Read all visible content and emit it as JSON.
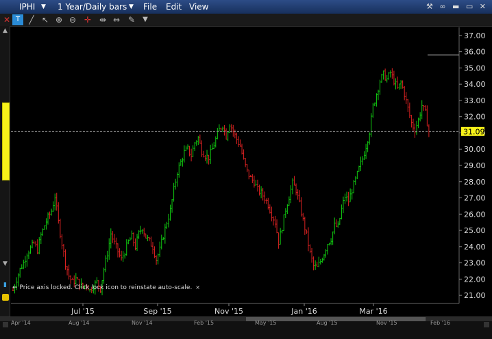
{
  "header": {
    "symbol": "IPHI",
    "period": "1 Year/Daily bars",
    "menu": [
      "File",
      "Edit",
      "View"
    ]
  },
  "note": {
    "text": "Price axis locked. Click lock icon to reinstate auto-scale."
  },
  "chart_data": {
    "type": "ohlc",
    "y_ticks": [
      "21.00",
      "22.00",
      "23.00",
      "24.00",
      "25.00",
      "26.00",
      "27.00",
      "28.00",
      "29.00",
      "30.00",
      "31.00",
      "32.00",
      "33.00",
      "34.00",
      "35.00",
      "36.00",
      "37.00"
    ],
    "ylim": [
      20.5,
      37.5
    ],
    "x_labels": [
      "Jul '15",
      "Sep '15",
      "Nov '15",
      "Jan '16",
      "Mar '16"
    ],
    "last_price": "31.09",
    "last_value": 31.09,
    "h_line_value": 35.8,
    "price_series": [
      [
        0,
        21.3
      ],
      [
        4,
        22.0
      ],
      [
        8,
        22.6
      ],
      [
        12,
        23.0
      ],
      [
        16,
        23.6
      ],
      [
        20,
        23.9
      ],
      [
        24,
        24.2
      ],
      [
        28,
        23.8
      ],
      [
        32,
        24.7
      ],
      [
        36,
        25.3
      ],
      [
        40,
        25.8
      ],
      [
        44,
        26.2
      ],
      [
        48,
        27.1
      ],
      [
        52,
        25.5
      ],
      [
        56,
        24.2
      ],
      [
        60,
        23.0
      ],
      [
        64,
        22.2
      ],
      [
        68,
        21.8
      ],
      [
        72,
        22.0
      ],
      [
        76,
        21.7
      ],
      [
        80,
        21.5
      ],
      [
        84,
        21.7
      ],
      [
        88,
        21.3
      ],
      [
        92,
        21.6
      ],
      [
        96,
        21.8
      ],
      [
        100,
        21.4
      ],
      [
        104,
        22.6
      ],
      [
        108,
        23.6
      ],
      [
        112,
        24.8
      ],
      [
        116,
        24.2
      ],
      [
        120,
        23.7
      ],
      [
        124,
        23.2
      ],
      [
        128,
        23.7
      ],
      [
        132,
        24.3
      ],
      [
        136,
        24.6
      ],
      [
        140,
        24.0
      ],
      [
        144,
        24.8
      ],
      [
        148,
        25.2
      ],
      [
        152,
        24.6
      ],
      [
        156,
        24.3
      ],
      [
        160,
        24.0
      ],
      [
        164,
        23.2
      ],
      [
        168,
        23.8
      ],
      [
        172,
        24.7
      ],
      [
        176,
        25.5
      ],
      [
        180,
        26.2
      ],
      [
        184,
        27.5
      ],
      [
        188,
        28.6
      ],
      [
        192,
        29.2
      ],
      [
        196,
        29.8
      ],
      [
        200,
        30.0
      ],
      [
        204,
        29.6
      ],
      [
        208,
        30.4
      ],
      [
        212,
        30.7
      ],
      [
        216,
        29.9
      ],
      [
        220,
        29.6
      ],
      [
        224,
        29.5
      ],
      [
        228,
        30.0
      ],
      [
        232,
        30.6
      ],
      [
        236,
        31.2
      ],
      [
        240,
        31.5
      ],
      [
        244,
        30.8
      ],
      [
        248,
        31.6
      ],
      [
        252,
        31.1
      ],
      [
        256,
        30.6
      ],
      [
        260,
        30.2
      ],
      [
        264,
        29.3
      ],
      [
        268,
        28.6
      ],
      [
        272,
        28.2
      ],
      [
        276,
        28.0
      ],
      [
        280,
        27.5
      ],
      [
        284,
        27.3
      ],
      [
        288,
        27.0
      ],
      [
        292,
        26.6
      ],
      [
        296,
        26.0
      ],
      [
        300,
        25.5
      ],
      [
        304,
        24.3
      ],
      [
        308,
        25.2
      ],
      [
        312,
        26.3
      ],
      [
        316,
        27.1
      ],
      [
        320,
        27.9
      ],
      [
        324,
        27.5
      ],
      [
        328,
        26.6
      ],
      [
        332,
        25.6
      ],
      [
        336,
        24.7
      ],
      [
        340,
        23.6
      ],
      [
        344,
        22.8
      ],
      [
        348,
        22.7
      ],
      [
        352,
        23.1
      ],
      [
        356,
        23.6
      ],
      [
        360,
        24.2
      ],
      [
        364,
        24.5
      ],
      [
        368,
        25.3
      ],
      [
        372,
        25.2
      ],
      [
        376,
        26.3
      ],
      [
        380,
        27.1
      ],
      [
        384,
        26.8
      ],
      [
        388,
        27.5
      ],
      [
        392,
        28.1
      ],
      [
        396,
        28.8
      ],
      [
        400,
        29.4
      ],
      [
        404,
        30.2
      ],
      [
        408,
        31.1
      ],
      [
        412,
        32.6
      ],
      [
        416,
        33.4
      ],
      [
        420,
        34.2
      ],
      [
        424,
        34.6
      ],
      [
        428,
        34.3
      ],
      [
        432,
        34.7
      ],
      [
        436,
        34.2
      ],
      [
        440,
        33.7
      ],
      [
        444,
        34.1
      ],
      [
        448,
        33.4
      ],
      [
        452,
        32.5
      ],
      [
        456,
        31.6
      ],
      [
        460,
        31.2
      ],
      [
        464,
        31.8
      ],
      [
        468,
        32.7
      ],
      [
        472,
        32.2
      ],
      [
        476,
        31.09
      ]
    ]
  },
  "navigator": {
    "labels": [
      "Apr '14",
      "Aug '14",
      "Nov '14",
      "Feb '15",
      "May '15",
      "Aug '15",
      "Nov '15",
      "Feb '16"
    ],
    "window": [
      0.5,
      0.88
    ]
  },
  "colors": {
    "up": "#11cc11",
    "down": "#dd2222",
    "axis": "#cccccc",
    "accent": "#f7f21a"
  }
}
